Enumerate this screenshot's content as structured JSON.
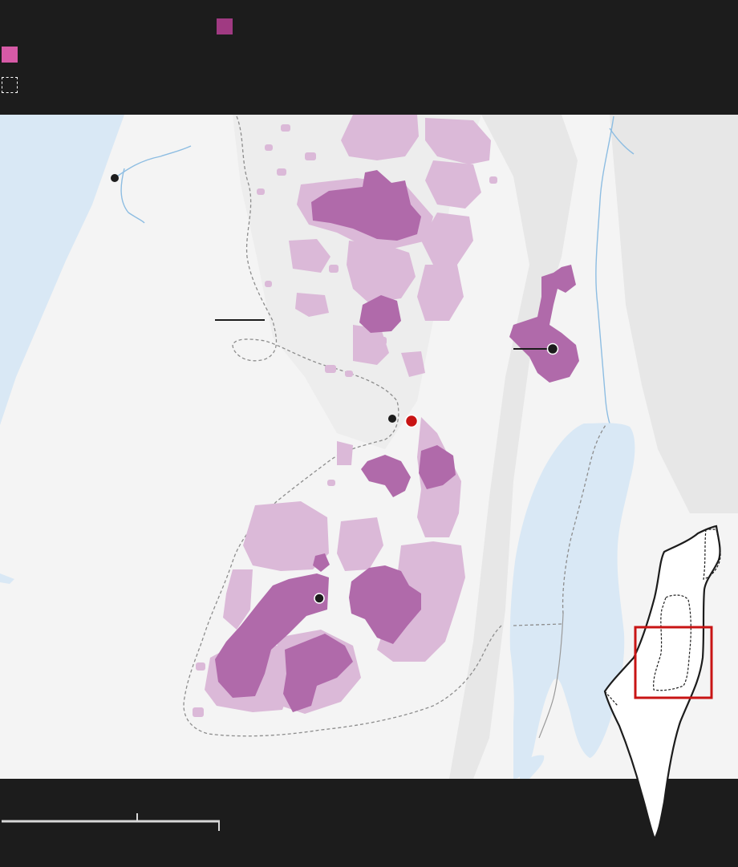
{
  "legend": {
    "items": [
      {
        "label": "",
        "color": "#a03a82",
        "icon": "area-a-swatch"
      },
      {
        "label": "",
        "color": "#d65aa6",
        "icon": "area-b-swatch"
      },
      {
        "label": "",
        "color": "#ffffff",
        "icon": "dashed-boundary-swatch"
      }
    ]
  },
  "map": {
    "colors": {
      "sea": "#d9e8f5",
      "land": "#f3f3f3",
      "area_a": "#b06aaa",
      "area_b": "#dbb9d8",
      "city_marker": "#1c1c1c",
      "highlight_marker": "#c81414",
      "border": "#8d8d8d"
    },
    "labels": {
      "city_west": "",
      "city_center": "",
      "city_east": "",
      "city_south": "",
      "callout_west": "",
      "callout_east": ""
    }
  },
  "footer": {
    "scale_label": "",
    "inset_highlight_color": "#c81414"
  }
}
